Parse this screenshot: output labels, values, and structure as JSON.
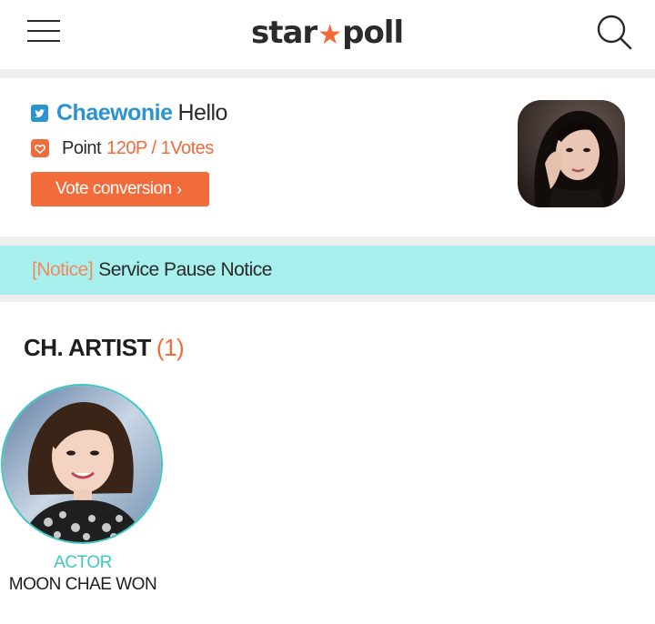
{
  "header": {
    "logo_left": "star",
    "logo_star": "★",
    "logo_right": "poll",
    "menu_icon": "hamburger-menu-icon",
    "search_icon": "search-icon"
  },
  "profile": {
    "username": "Chaewonie",
    "greeting": "Hello",
    "point_label": "Point",
    "point_value": "120P / 1Votes",
    "vote_button": "Vote conversion",
    "vote_chevron": "›"
  },
  "notice": {
    "tag": "[Notice]",
    "title": "Service Pause Notice"
  },
  "section": {
    "title": "CH. ARTIST",
    "count": "(1)"
  },
  "artists": [
    {
      "role": "ACTOR",
      "name": "MOON CHAE WON"
    }
  ],
  "colors": {
    "accent_orange": "#f26b3a",
    "twitter_blue": "#2b93cf",
    "notice_bg": "#a8f0ee",
    "teal": "#3ec7c2"
  }
}
